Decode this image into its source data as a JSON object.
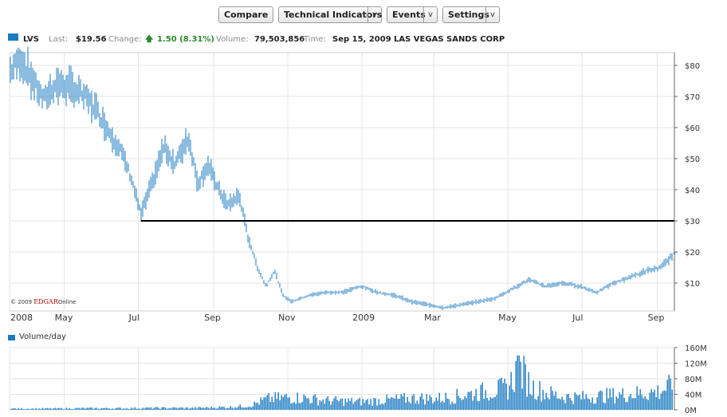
{
  "toolbar": {
    "compare": "Compare",
    "technical": "Technical Indicators",
    "events": "Events",
    "settings": "Settings",
    "arrow": "v"
  },
  "quote": {
    "symbol": "LVS",
    "last_label": "Last:",
    "last": "$19.56",
    "change_label": "Change:",
    "change": "1.50 (8.31%)",
    "volume_label": "Volume:",
    "volume": "79,503,856",
    "time_label": "Time:",
    "time": "Sep 15, 2009",
    "company": "LAS VEGAS SANDS CORP"
  },
  "copyright": {
    "prefix": "© 2009",
    "brand": "EDGAR",
    "suffix": "Online"
  },
  "volume_panel": {
    "label": "Volume/day"
  },
  "colors": {
    "series": "#1a7ac2",
    "grid": "#e4e4e4",
    "support_line": "#000000",
    "change_up": "#2a8a2a"
  },
  "chart_data": [
    {
      "type": "line",
      "title": "",
      "ylabel": "",
      "y_ticks": [
        "$10",
        "$20",
        "$30",
        "$40",
        "$50",
        "$60",
        "$70",
        "$80"
      ],
      "y_tick_values": [
        10,
        20,
        30,
        40,
        50,
        60,
        70,
        80
      ],
      "ylim": [
        0,
        85
      ],
      "x_ticks": [
        "2008",
        "May",
        "Jul",
        "Sep",
        "Nov",
        "2009",
        "Mar",
        "May",
        "Jul",
        "Sep"
      ],
      "x_tick_dates": [
        "2008-03-17",
        "2008-05-01",
        "2008-07-01",
        "2008-09-01",
        "2008-11-01",
        "2009-01-01",
        "2009-03-01",
        "2009-05-01",
        "2009-07-01",
        "2009-09-01"
      ],
      "x_range": [
        "2008-03-17",
        "2009-09-15"
      ],
      "series": [
        {
          "values_date": [
            "2008-03-17",
            "2008-03-26",
            "2008-04-04",
            "2008-04-14",
            "2008-04-24",
            "2008-05-05",
            "2008-05-15",
            "2008-05-27",
            "2008-06-05",
            "2008-06-16",
            "2008-06-25",
            "2008-07-03",
            "2008-07-14",
            "2008-07-22",
            "2008-07-31",
            "2008-08-11",
            "2008-08-19",
            "2008-08-27",
            "2008-09-05",
            "2008-09-12",
            "2008-09-22",
            "2008-09-29",
            "2008-10-07",
            "2008-10-14",
            "2008-10-21",
            "2008-10-28",
            "2008-11-04",
            "2008-11-18",
            "2008-12-02",
            "2008-12-16",
            "2008-12-31",
            "2009-01-14",
            "2009-01-28",
            "2009-02-11",
            "2009-02-25",
            "2009-03-09",
            "2009-03-23",
            "2009-04-06",
            "2009-04-20",
            "2009-05-04",
            "2009-05-18",
            "2009-06-01",
            "2009-06-15",
            "2009-06-29",
            "2009-07-13",
            "2009-07-27",
            "2009-08-10",
            "2009-08-24",
            "2009-09-04",
            "2009-09-15"
          ],
          "values": [
            78,
            82,
            76,
            69,
            74,
            73,
            71,
            66,
            60,
            53,
            44,
            32,
            44,
            54,
            48,
            57,
            42,
            48,
            40,
            35,
            38,
            25,
            15,
            9,
            14,
            6,
            4,
            6,
            7,
            7,
            9,
            7,
            6,
            4,
            3,
            2,
            3,
            4,
            5,
            8,
            11,
            9,
            10,
            9,
            7,
            10,
            12,
            14,
            15,
            19.56
          ]
        }
      ],
      "annotations": [
        {
          "type": "horizontal_line",
          "y": 30,
          "x_start": "2008-07-03",
          "x_end": "2009-09-15"
        }
      ],
      "grid": true
    },
    {
      "type": "bar",
      "title": "",
      "ylabel": "",
      "y_ticks": [
        "0M",
        "40M",
        "80M",
        "120M",
        "160M"
      ],
      "y_tick_values": [
        0,
        40,
        80,
        120,
        160
      ],
      "ylim": [
        0,
        160
      ],
      "x_range": [
        "2008-03-17",
        "2009-09-15"
      ],
      "unit": "M",
      "series": [
        {
          "values_date": [
            "2008-03-17",
            "2008-04-15",
            "2008-05-15",
            "2008-06-15",
            "2008-07-15",
            "2008-08-15",
            "2008-09-15",
            "2008-10-01",
            "2008-10-15",
            "2008-11-01",
            "2008-11-15",
            "2008-12-01",
            "2008-12-15",
            "2009-01-01",
            "2009-01-15",
            "2009-02-01",
            "2009-02-15",
            "2009-03-01",
            "2009-03-15",
            "2009-04-01",
            "2009-04-15",
            "2009-05-01",
            "2009-05-10",
            "2009-05-20",
            "2009-06-01",
            "2009-06-15",
            "2009-07-01",
            "2009-07-15",
            "2009-08-01",
            "2009-08-15",
            "2009-09-01",
            "2009-09-15"
          ],
          "values": [
            4,
            4,
            5,
            5,
            6,
            6,
            9,
            14,
            35,
            40,
            38,
            30,
            28,
            26,
            30,
            34,
            38,
            36,
            40,
            52,
            60,
            70,
            140,
            75,
            55,
            42,
            40,
            44,
            48,
            52,
            58,
            80
          ]
        }
      ],
      "grid": true
    }
  ]
}
